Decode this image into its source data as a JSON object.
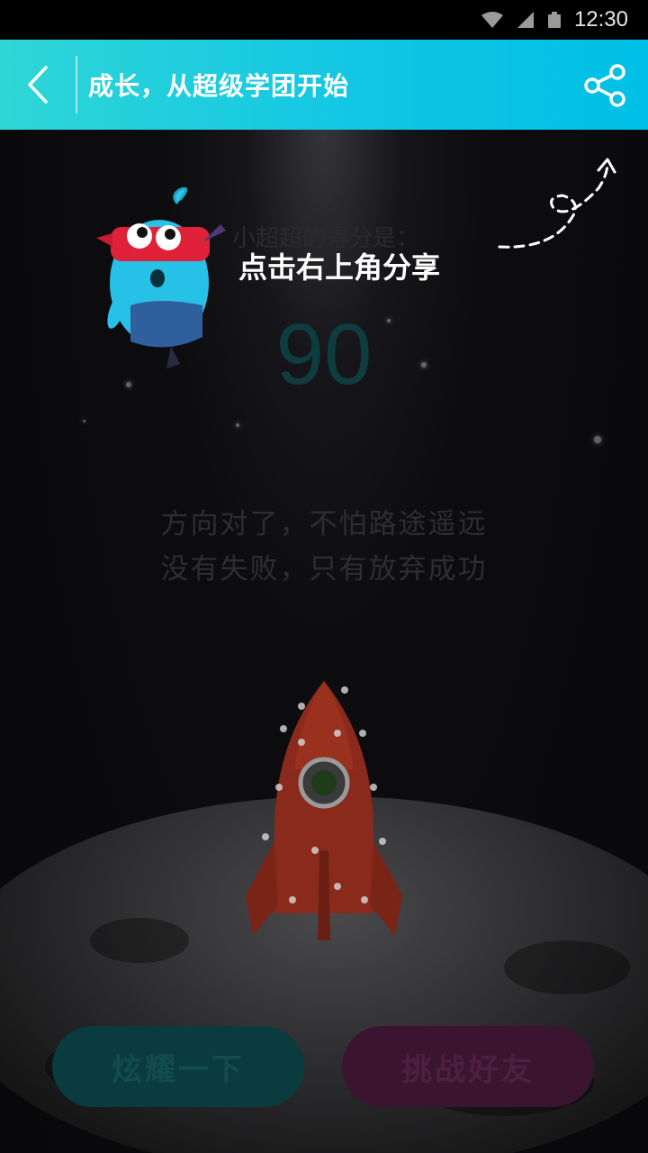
{
  "status_bar": {
    "time": "12:30"
  },
  "app_bar": {
    "title": "成长，从超级学团开始"
  },
  "overlay": {
    "hint": "点击右上角分享"
  },
  "score": {
    "label": "小超超的得分是：",
    "value": "90"
  },
  "quote": {
    "line1": "方向对了，不怕路途遥远",
    "line2": "没有失败，只有放弃成功"
  },
  "buttons": {
    "show_off": "炫耀一下",
    "challenge": "挑战好友"
  },
  "colors": {
    "appbar_start": "#2fd6d6",
    "appbar_end": "#00bfe6",
    "score_color": "#0f3c3e",
    "show_btn": "#0a3b3f",
    "challenge_btn": "#3b1430"
  },
  "icons": [
    "wifi-icon",
    "signal-icon",
    "battery-icon",
    "back-arrow-icon",
    "share-icon"
  ]
}
